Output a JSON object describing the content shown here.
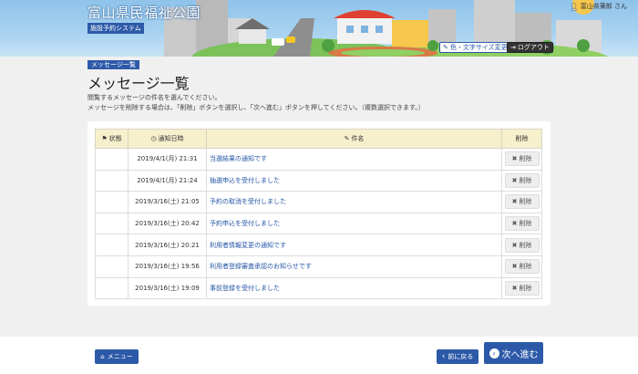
{
  "header": {
    "site_title": "富山県民福祉公園",
    "site_subtitle": "施設予約システム",
    "user_name": "富山県薬郎 さん",
    "font_button": "色・文字サイズ変更",
    "logout_button": "ログアウト"
  },
  "page": {
    "breadcrumb": "メッセージ一覧",
    "title": "メッセージ一覧",
    "desc1": "閲覧するメッセージの件名を選んでください。",
    "desc2": "メッセージを削除する場合は、「削除」ボタンを選択し、「次へ進む」ボタンを押してください。（複数選択できます。）"
  },
  "table": {
    "headers": {
      "status": "状態",
      "date": "通知日時",
      "subject": "件名",
      "delete": "削除"
    },
    "rows": [
      {
        "status": "",
        "date": "2019/4/1(月) 21:31",
        "subject": "当選結果の通知です",
        "delete": "削除"
      },
      {
        "status": "",
        "date": "2019/4/1(月) 21:24",
        "subject": "抽選申込を受付しました",
        "delete": "削除"
      },
      {
        "status": "",
        "date": "2019/3/16(土) 21:05",
        "subject": "予約の取消を受付しました",
        "delete": "削除"
      },
      {
        "status": "",
        "date": "2019/3/16(土) 20:42",
        "subject": "予約申込を受付しました",
        "delete": "削除"
      },
      {
        "status": "",
        "date": "2019/3/16(土) 20:21",
        "subject": "利用者情報変更の通知です",
        "delete": "削除"
      },
      {
        "status": "",
        "date": "2019/3/16(土) 19:56",
        "subject": "利用者登録審査承認のお知らせです",
        "delete": "削除"
      },
      {
        "status": "",
        "date": "2019/3/16(土) 19:09",
        "subject": "事前登録を受付しました",
        "delete": "削除"
      }
    ]
  },
  "footer": {
    "menu_button": "メニュー",
    "back_button": "前に戻る",
    "next_button": "次へ進む"
  },
  "icons": {
    "user": "user-icon",
    "pencil": "pencil-icon",
    "logout": "logout-icon",
    "flag": "flag-icon",
    "clock": "clock-icon",
    "times": "times-icon",
    "home": "home-icon",
    "chevron_left": "chevron-left-icon",
    "chevron_right": "chevron-right-icon"
  },
  "colors": {
    "primary": "#2d5aa8",
    "table_header": "#f7f0cd",
    "link": "#2456a6",
    "background": "#f0f0f0"
  }
}
